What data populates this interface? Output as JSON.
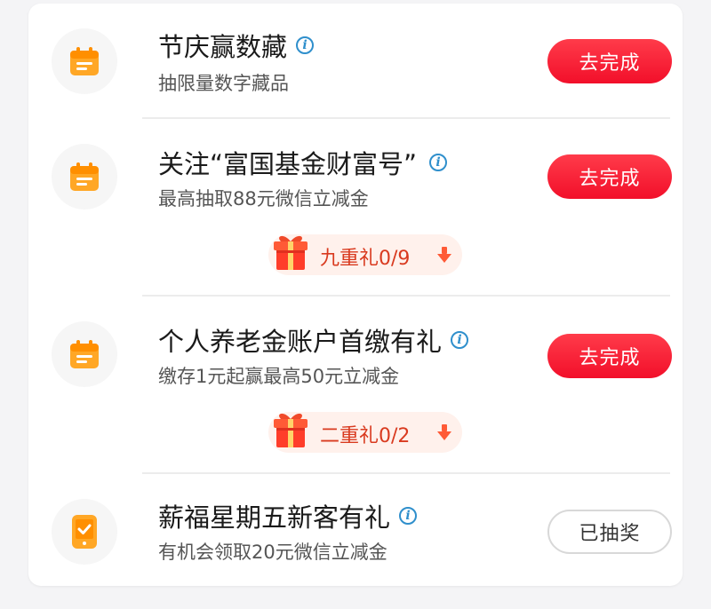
{
  "tasks": [
    {
      "title": "节庆赢数藏",
      "subtitle": "抽限量数字藏品",
      "button": "去完成",
      "icon": "calendar-icon"
    },
    {
      "title": "关注“富国基金财富号”",
      "subtitle": "最高抽取88元微信立减金",
      "button": "去完成",
      "icon": "calendar-icon",
      "gift": {
        "label": "九重礼0/9",
        "progress": 0,
        "total": 9
      }
    },
    {
      "title": "个人养老金账户首缴有礼",
      "subtitle": "缴存1元起赢最高50元立减金",
      "button": "去完成",
      "icon": "calendar-icon",
      "gift": {
        "label": "二重礼0/2",
        "progress": 0,
        "total": 2
      }
    },
    {
      "title": "薪福星期五新客有礼",
      "subtitle": "有机会领取20元微信立减金",
      "button": "已抽奖",
      "icon": "phone-check-icon"
    }
  ],
  "colors": {
    "accent_red": "#f20f2a",
    "icon_orange": "#ff9a1f",
    "info_blue": "#2f8fcc",
    "gift_text": "#d93a1f"
  }
}
